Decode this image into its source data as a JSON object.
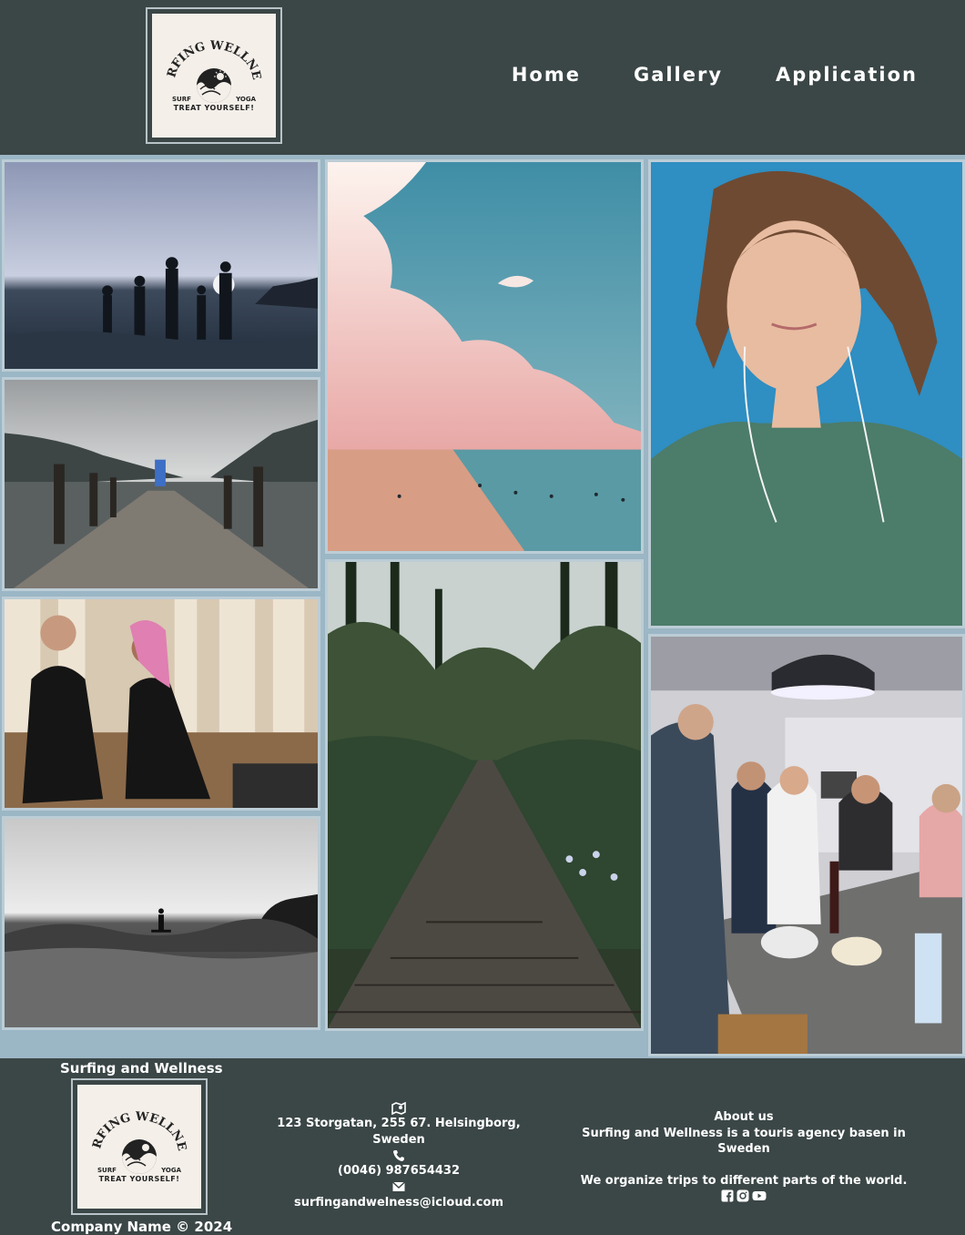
{
  "logo": {
    "title": "SURFING WELLNESS",
    "left_word": "SURF",
    "right_word": "YOGA",
    "tagline": "TREAT YOURSELF!"
  },
  "nav": {
    "items": [
      {
        "label": "Home"
      },
      {
        "label": "Gallery"
      },
      {
        "label": "Application"
      }
    ]
  },
  "gallery": {
    "images": [
      {
        "subject": "silhouettes of friends jumping on a beach at sunset"
      },
      {
        "subject": "person standing at end of wooden pier on a lake"
      },
      {
        "subject": "man and woman meditating in a yoga studio"
      },
      {
        "subject": "surfer riding a wave in black and white"
      },
      {
        "subject": "pink clouds over the sea with swimmers"
      },
      {
        "subject": "wooden suspension bridge in a forest"
      },
      {
        "subject": "woman lying on a blue mat with earphones"
      },
      {
        "subject": "friends cooking together in a kitchen"
      }
    ]
  },
  "footer": {
    "brand": "Surfing and Wellness",
    "copyright": "Company Name © 2024",
    "address": "123 Storgatan, 255 67. Helsingborg, Sweden",
    "phone": "(0046) 987654432",
    "email": "surfingandwelness@icloud.com",
    "about_title": "About us",
    "about_line1": "Surfing and Wellness is a touris agency basen in Sweden",
    "about_line2": "We organize trips to different parts of the world.",
    "socials": [
      {
        "icon": "facebook-icon"
      },
      {
        "icon": "instagram-icon"
      },
      {
        "icon": "youtube-icon"
      }
    ]
  }
}
